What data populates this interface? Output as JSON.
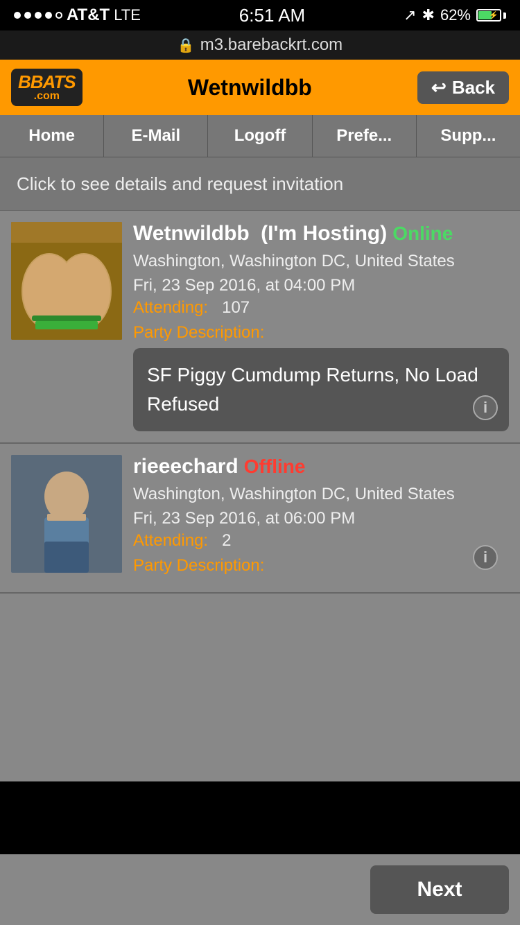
{
  "statusBar": {
    "carrier": "AT&T",
    "network": "LTE",
    "time": "6:51 AM",
    "battery": "62%",
    "dots": [
      1,
      1,
      1,
      1,
      0
    ]
  },
  "addressBar": {
    "url": "m3.barebackrt.com",
    "lockSymbol": "🔒"
  },
  "header": {
    "logoTop": "BBATS",
    "logoBottom": ".com",
    "title": "Wetnwildbb",
    "backLabel": "Back"
  },
  "navTabs": [
    {
      "label": "Home"
    },
    {
      "label": "E-Mail"
    },
    {
      "label": "Logoff"
    },
    {
      "label": "Prefe..."
    },
    {
      "label": "Supp..."
    }
  ],
  "clickBanner": {
    "text": "Click to see details and request invitation"
  },
  "parties": [
    {
      "username": "Wetnwildbb",
      "hostingLabel": "(I'm Hosting)",
      "status": "Online",
      "statusType": "online",
      "location": "Washington, Washington DC, United States",
      "date": "Fri, 23 Sep 2016, at 04:00 PM",
      "attendingLabel": "Attending:",
      "attendingCount": "107",
      "partyDescLabel": "Party Description:",
      "description": "SF Piggy Cumdump Returns, No Load Refused",
      "infoIcon": "i"
    },
    {
      "username": "rieeechard",
      "hostingLabel": "",
      "status": "Offline",
      "statusType": "offline",
      "location": "Washington, Washington DC, United States",
      "date": "Fri, 23 Sep 2016, at 06:00 PM",
      "attendingLabel": "Attending:",
      "attendingCount": "2",
      "partyDescLabel": "Party Description:",
      "description": "",
      "infoIcon": "i"
    }
  ],
  "bottomBar": {
    "nextLabel": "Next"
  }
}
